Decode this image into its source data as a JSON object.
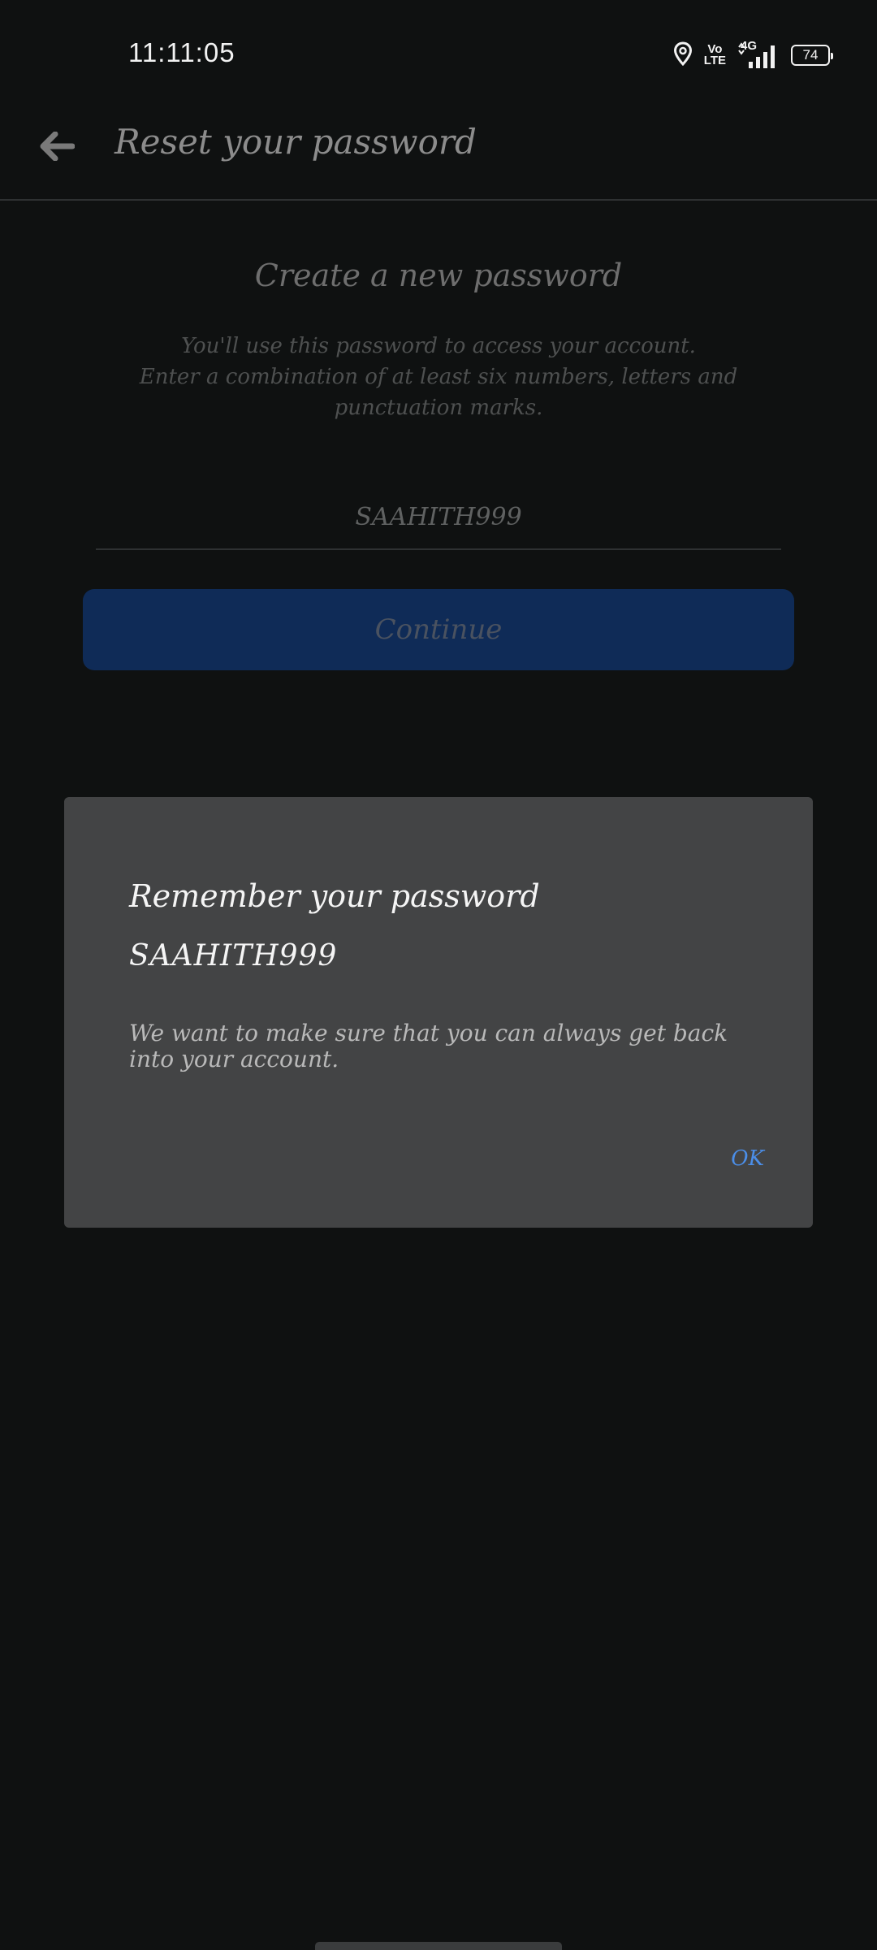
{
  "status_bar": {
    "time": "11:11:05",
    "volte_top": "Vo",
    "volte_bottom": "LTE",
    "network": "4G",
    "battery": "74",
    "icons": [
      "location-icon",
      "volte-icon",
      "signal-icon",
      "battery-icon"
    ]
  },
  "app_bar": {
    "title": "Reset your password",
    "back_icon": "arrow-left-icon"
  },
  "form": {
    "heading": "Create a new password",
    "subtext_line1": "You'll use this password to access your account.",
    "subtext_line2": "Enter a combination of at least six numbers, letters and punctuation marks.",
    "password_value": "SAAHITH999",
    "continue_label": "Continue"
  },
  "dialog": {
    "title": "Remember your password",
    "password": "SAAHITH999",
    "message": "We want to make sure that you can always get back into your account.",
    "ok_label": "OK"
  },
  "colors": {
    "background": "#0f1111",
    "button": "#0f2b57",
    "dialog": "#434445",
    "accent": "#4b8ee8"
  }
}
